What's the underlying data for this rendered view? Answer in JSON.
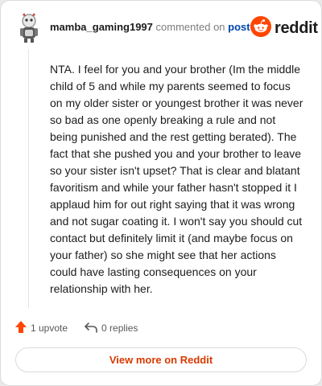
{
  "comment": {
    "username": "mamba_gaming1997",
    "commented_on_text": "commented on",
    "post_link_text": "post",
    "body": "NTA. I feel for you and your brother (Im the middle child of 5 and while my parents seemed to focus on my older sister or youngest brother it was never so bad as one openly breaking a rule and not being punished and the rest getting berated). The fact that she pushed you and your brother to leave so your sister isn't upset? That is clear and blatant favoritism and while your father hasn't stopped it I applaud him for out right saying that it was wrong and not sugar coating it. I won't say you should cut contact but definitely limit it (and maybe focus on your father) so she might see that her actions could have lasting consequences on your relationship with her."
  },
  "brand": {
    "name": "reddit",
    "icon": "reddit-snoo-icon",
    "color": "#ff4500"
  },
  "actions": {
    "upvote_label": "1 upvote",
    "upvote_icon": "upvote-arrow-icon",
    "upvote_color": "#ff4500",
    "reply_label": "0 replies",
    "reply_icon": "reply-arrow-icon"
  },
  "footer": {
    "view_more_label": "View more on Reddit",
    "view_more_color": "#d93a00"
  }
}
